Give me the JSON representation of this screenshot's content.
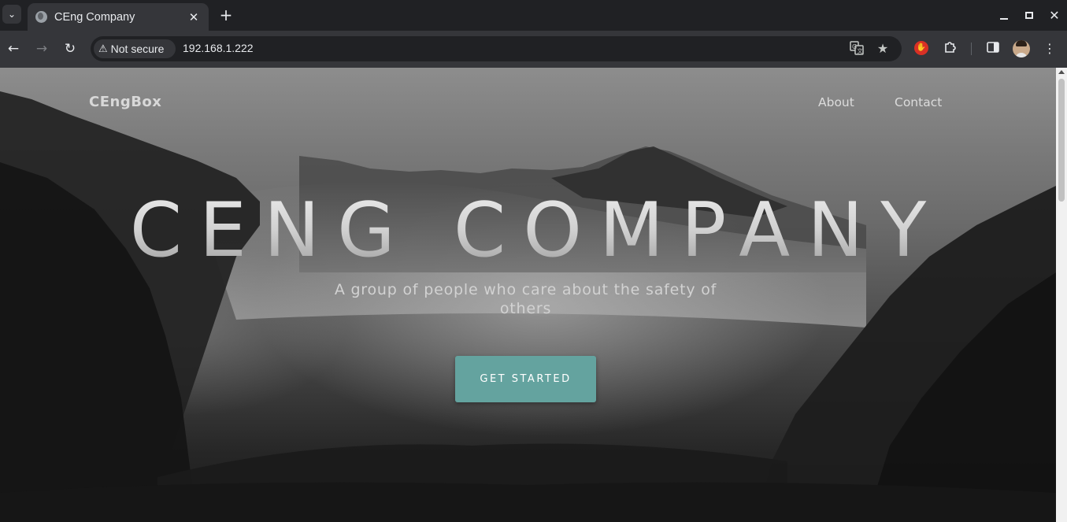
{
  "browser": {
    "tab": {
      "title": "CEng Company",
      "close": "✕"
    },
    "new_tab": "+",
    "window": {
      "close": "✕"
    },
    "nav": {
      "back": "←",
      "forward": "→",
      "reload": "↻"
    },
    "omnibox": {
      "security_icon": "⚠",
      "security_label": "Not secure",
      "url": "192.168.1.222",
      "translate_icon": "translate-icon",
      "bookmark_icon": "★"
    },
    "toolbar_icons": [
      "ext-red-icon",
      "puzzle-icon",
      "sidebar-icon",
      "avatar",
      "kebab-menu-icon"
    ]
  },
  "page": {
    "brand": "CEngBox",
    "nav": [
      {
        "label": "About"
      },
      {
        "label": "Contact"
      }
    ],
    "hero": {
      "title": "CENG COMPANY",
      "subtitle": "A group of people who care about the safety of others",
      "cta_label": "GET STARTED"
    },
    "colors": {
      "cta": "#64a39f",
      "chrome_dark": "#202124",
      "chrome_toolbar": "#35363a"
    }
  }
}
